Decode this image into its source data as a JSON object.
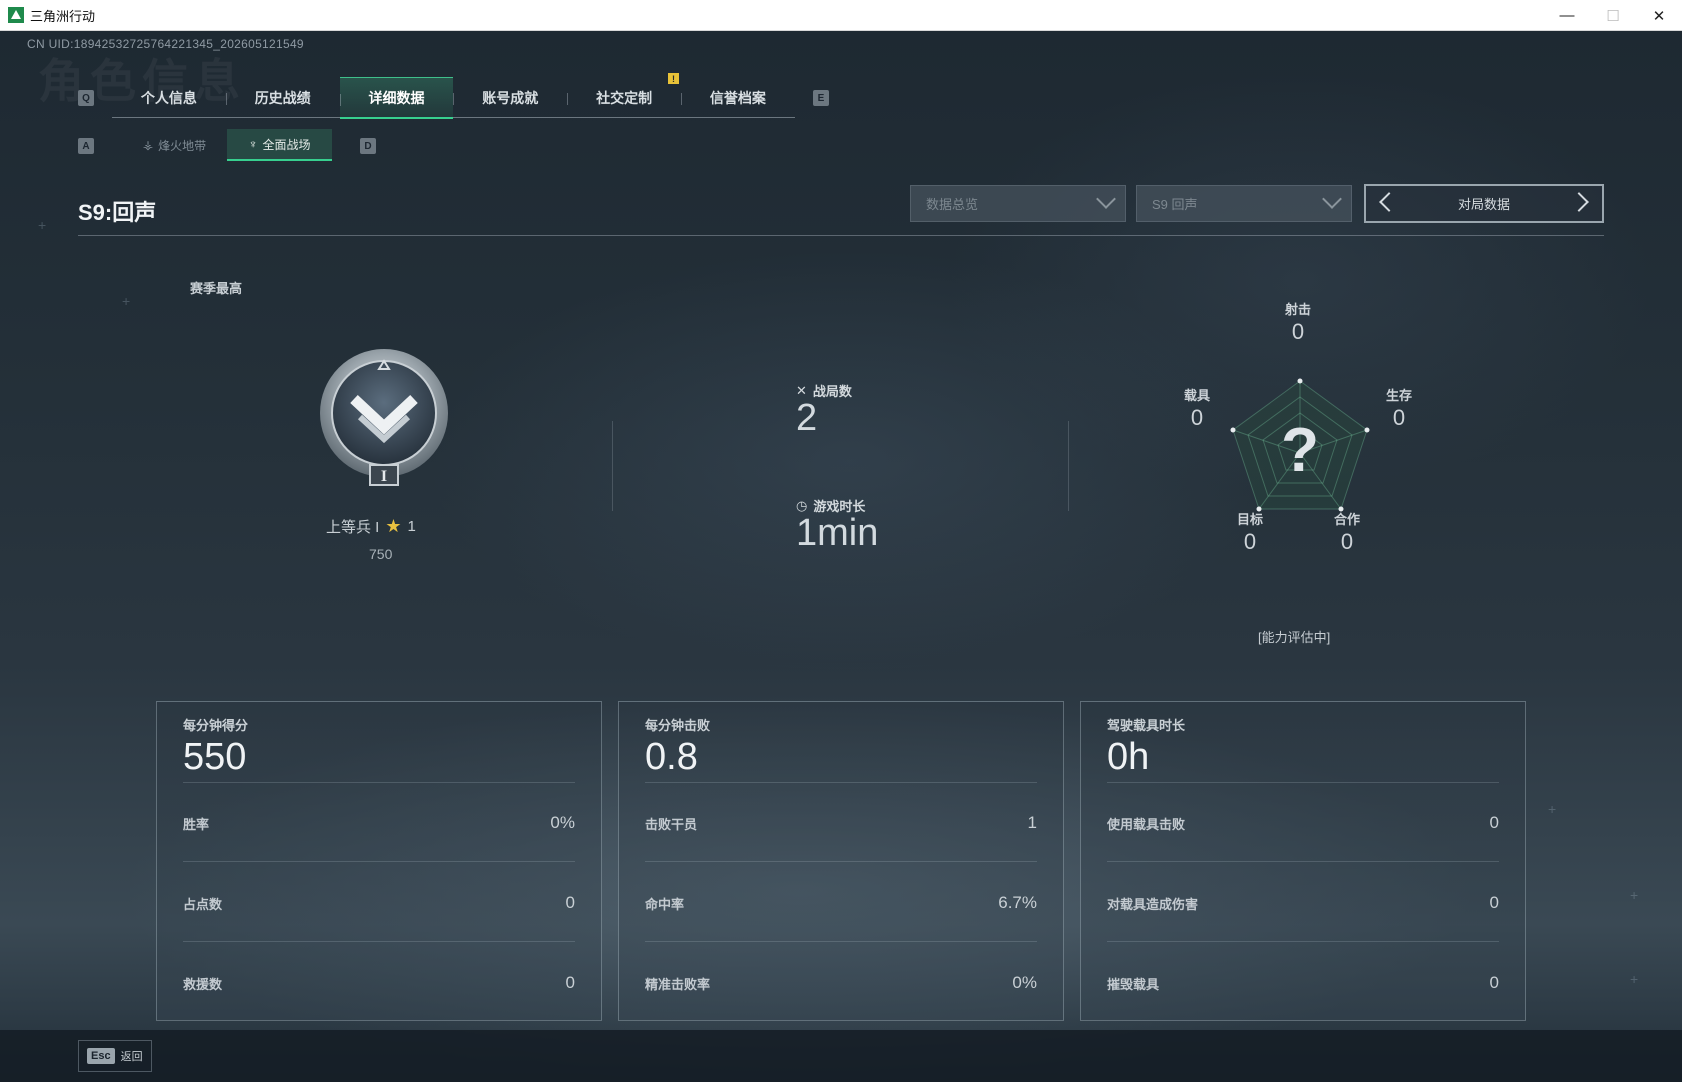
{
  "window": {
    "title": "三角洲行动",
    "minimize": "—",
    "maximize": "☐",
    "close": "✕"
  },
  "uid": "CN UID:189425327257642213​45_202605121549",
  "watermark": "角色信息",
  "main_tabs": {
    "key_left": "Q",
    "key_right": "E",
    "notice": "!",
    "items": [
      {
        "label": "个人信息"
      },
      {
        "label": "历史战绩"
      },
      {
        "label": "详细数据"
      },
      {
        "label": "账号成就"
      },
      {
        "label": "社交定制"
      },
      {
        "label": "信誉档案"
      }
    ]
  },
  "sub_tabs": {
    "key_left": "A",
    "key_right": "D",
    "items": [
      {
        "label": "烽火地带",
        "icon": "⚶"
      },
      {
        "label": "全面战场",
        "icon": "♆"
      }
    ]
  },
  "season": {
    "title": "S9:回声",
    "dropdown_1": "数据总览",
    "dropdown_2": "S9 回声",
    "pager_label": "对局数据"
  },
  "rank": {
    "section_label": "赛季最高",
    "name": "上等兵 I",
    "stars": "1",
    "star_icon": "★",
    "score": "750",
    "badge_numeral": "I"
  },
  "overview": {
    "matches_label": "战局数",
    "matches_value": "2",
    "time_label": "游戏时长",
    "time_value": "1min"
  },
  "radar": {
    "center": "?",
    "axes": [
      {
        "label": "射击",
        "value": "0"
      },
      {
        "label": "生存",
        "value": "0"
      },
      {
        "label": "合作",
        "value": "0"
      },
      {
        "label": "目标",
        "value": "0"
      },
      {
        "label": "载具",
        "value": "0"
      }
    ],
    "note": "[能力评估中]"
  },
  "cards": [
    {
      "header": "每分钟得分",
      "big": "550",
      "rows": [
        {
          "k": "胜率",
          "v": "0%"
        },
        {
          "k": "占点数",
          "v": "0"
        },
        {
          "k": "救援数",
          "v": "0"
        }
      ]
    },
    {
      "header": "每分钟击败",
      "big": "0.8",
      "rows": [
        {
          "k": "击败干员",
          "v": "1"
        },
        {
          "k": "命中率",
          "v": "6.7%"
        },
        {
          "k": "精准击败率",
          "v": "0%"
        }
      ]
    },
    {
      "header": "驾驶载具时长",
      "big": "0h",
      "rows": [
        {
          "k": "使用载具击败",
          "v": "0"
        },
        {
          "k": "对载具造成伤害",
          "v": "0"
        },
        {
          "k": "摧毁载具",
          "v": "0"
        }
      ]
    }
  ],
  "footer": {
    "esc_key": "Esc",
    "esc_label": "返回"
  }
}
